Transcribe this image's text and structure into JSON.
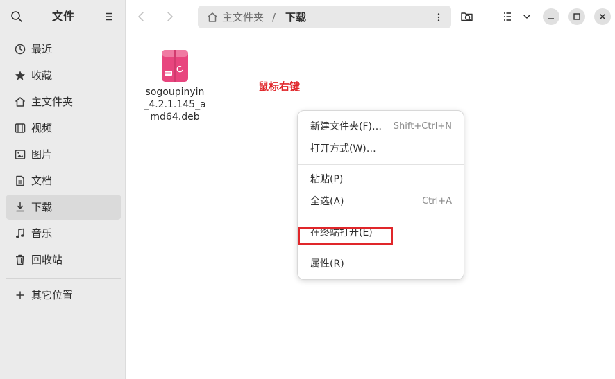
{
  "sidebar": {
    "title": "文件",
    "items": [
      {
        "label": "最近",
        "icon": "clock-icon"
      },
      {
        "label": "收藏",
        "icon": "star-icon"
      },
      {
        "label": "主文件夹",
        "icon": "home-icon"
      },
      {
        "label": "视频",
        "icon": "film-icon"
      },
      {
        "label": "图片",
        "icon": "image-icon"
      },
      {
        "label": "文档",
        "icon": "document-icon"
      },
      {
        "label": "下载",
        "icon": "download-icon",
        "active": true
      },
      {
        "label": "音乐",
        "icon": "music-icon"
      },
      {
        "label": "回收站",
        "icon": "trash-icon"
      }
    ],
    "other_locations": "其它位置"
  },
  "pathbar": {
    "segment1": "主文件夹",
    "separator": "/",
    "segment2": "下载"
  },
  "file": {
    "name": "sogoupinyin_4.2.1.145_amd64.deb"
  },
  "annotation": "鼠标右键",
  "context_menu": {
    "new_folder": {
      "label": "新建文件夹(F)…",
      "shortcut": "Shift+Ctrl+N"
    },
    "open_with": {
      "label": "打开方式(W)…"
    },
    "paste": {
      "label": "粘贴(P)"
    },
    "select_all": {
      "label": "全选(A)",
      "shortcut": "Ctrl+A"
    },
    "open_terminal": {
      "label": "在终端打开(E)"
    },
    "properties": {
      "label": "属性(R)"
    }
  },
  "colors": {
    "accent_red": "#e0262a",
    "sidebar_bg": "#ebebeb",
    "file_icon_pink": "#e8457e"
  }
}
